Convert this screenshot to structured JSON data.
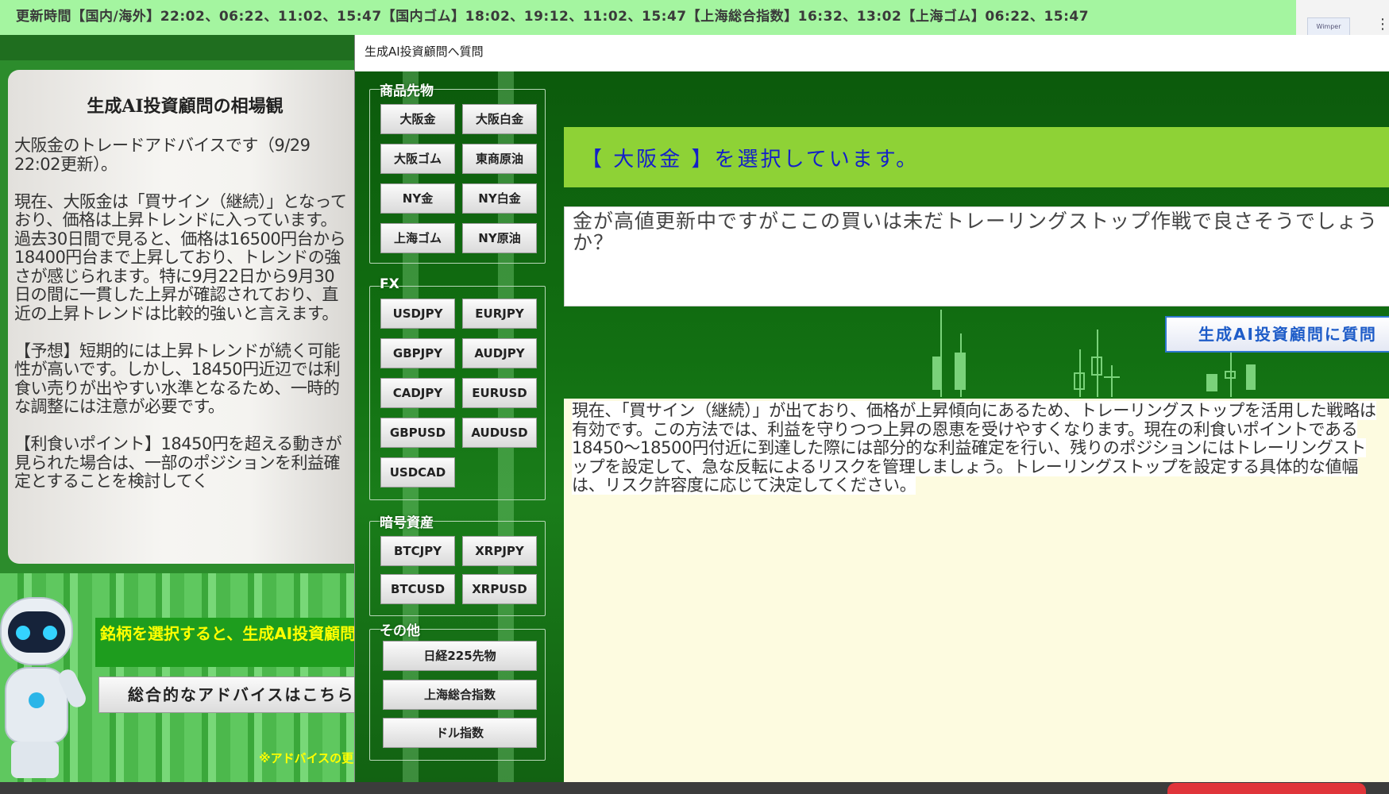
{
  "ticker": {
    "text": "更新時間【国内/海外】22:02、06:22、11:02、15:47【国内ゴム】18:02、19:12、11:02、15:47【上海総合指数】16:32、13:02【上海ゴム】06:22、15:47"
  },
  "topright": {
    "thumb_label": "Wimper"
  },
  "advice": {
    "title": "生成AI投資顧問の相場観",
    "paragraphs": [
      "大阪金のトレードアドバイスです（9/29 22:02更新）。",
      "現在、大阪金は「買サイン（継続）」となっており、価格は上昇トレンドに入っています。過去30日間で見ると、価格は16500円台から18400円台まで上昇しており、トレンドの強さが感じられます。特に9月22日から9月30日の間に一貫した上昇が確認されており、直近の上昇トレンドは比較的強いと言えます。",
      "【予想】短期的には上昇トレンドが続く可能性が高いです。しかし、18450円近辺では利食い売りが出やすい水準となるため、一時的な調整には注意が必要です。",
      "【利食いポイント】18450円を超える動きが見られた場合は、一部のポジションを利益確定とすることを検討してく"
    ]
  },
  "left_bottom": {
    "hint": "銘柄を選択すると、生成AI投資顧問からのアドバイスが表示されます。",
    "overall_button": "総合的なアドバイスはこちら",
    "note": "※アドバイスの更"
  },
  "dialog": {
    "title": "生成AI投資顧問へ質問",
    "groups": {
      "commodities": {
        "label": "商品先物",
        "items": [
          "大阪金",
          "大阪白金",
          "大阪ゴム",
          "東商原油",
          "NY金",
          "NY白金",
          "上海ゴム",
          "NY原油"
        ]
      },
      "fx": {
        "label": "FX",
        "items": [
          "USDJPY",
          "EURJPY",
          "GBPJPY",
          "AUDJPY",
          "CADJPY",
          "EURUSD",
          "GBPUSD",
          "AUDUSD",
          "USDCAD"
        ]
      },
      "crypto": {
        "label": "暗号資産",
        "items": [
          "BTCJPY",
          "XRPJPY",
          "BTCUSD",
          "XRPUSD"
        ]
      },
      "other": {
        "label": "その他",
        "items": [
          "日経225先物",
          "上海総合指数",
          "ドル指数"
        ]
      }
    },
    "selected": "【 大阪金 】を選択しています。",
    "question": "金が高値更新中ですがここの買いは未だトレーリングストップ作戦で良さそうでしょうか？",
    "ask_button": "生成AI投資顧問に質問",
    "answer": "現在、「買サイン（継続）」が出ており、価格が上昇傾向にあるため、トレーリングストップを活用した戦略は有効です。この方法では、利益を守りつつ上昇の恩恵を受けやすくなります。現在の利食いポイントである18450～18500円付近に到達した際には部分的な利益確定を行い、残りのポジションにはトレーリングストップを設定して、急な反転によるリスクを管理しましょう。トレーリングストップを設定する具体的な値幅は、リスク許容度に応じて決定してください。"
  },
  "colors": {
    "ticker_bg": "#a4f5a0",
    "selected_bar": "#8ed236",
    "selected_text": "#1420c8",
    "answer_bg": "#fdfbe0",
    "dialog_green": "#127012",
    "hint_text": "#ffff00"
  }
}
